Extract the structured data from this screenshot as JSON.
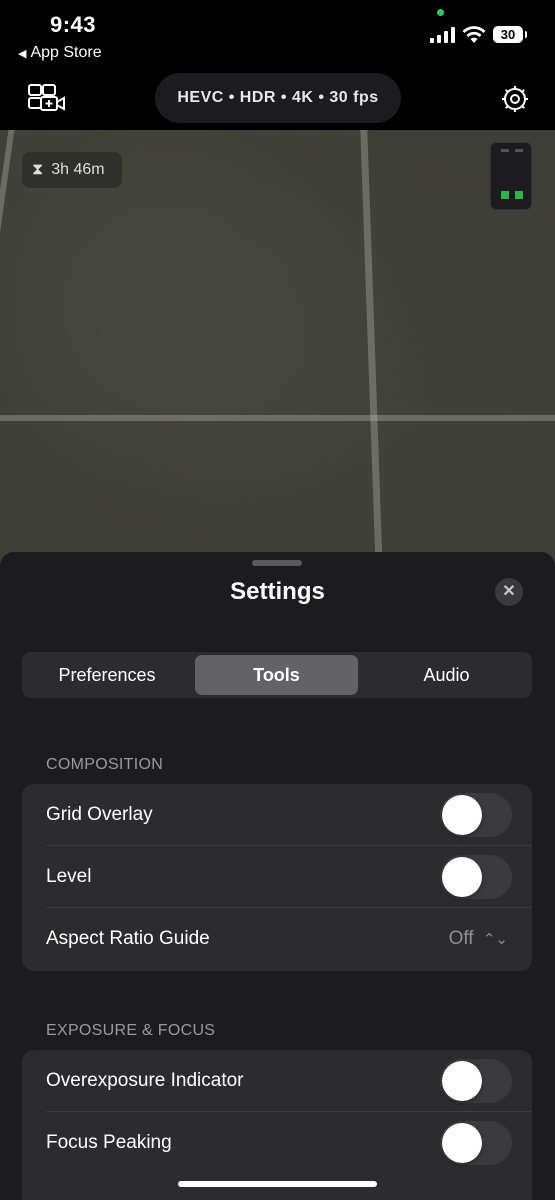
{
  "status_bar": {
    "time": "9:43",
    "back_label": "App Store",
    "battery": "30",
    "mic_indicator_color": "#33c759"
  },
  "toolbar": {
    "format": "HEVC • HDR • 4K • 30 fps",
    "left_icon": "camera-multi-icon",
    "right_icon": "gear-icon"
  },
  "viewfinder": {
    "remaining_time": "3h 46m",
    "meter_color": "#30b14a"
  },
  "settings": {
    "title": "Settings",
    "tabs": [
      {
        "label": "Preferences",
        "active": false
      },
      {
        "label": "Tools",
        "active": true
      },
      {
        "label": "Audio",
        "active": false
      }
    ],
    "sections": [
      {
        "header": "COMPOSITION",
        "rows": [
          {
            "label": "Grid Overlay",
            "type": "toggle",
            "on": false
          },
          {
            "label": "Level",
            "type": "toggle",
            "on": false
          },
          {
            "label": "Aspect Ratio Guide",
            "type": "select",
            "value": "Off"
          }
        ]
      },
      {
        "header": "EXPOSURE & FOCUS",
        "rows": [
          {
            "label": "Overexposure Indicator",
            "type": "toggle",
            "on": false
          },
          {
            "label": "Focus Peaking",
            "type": "toggle",
            "on": false
          }
        ]
      }
    ]
  }
}
